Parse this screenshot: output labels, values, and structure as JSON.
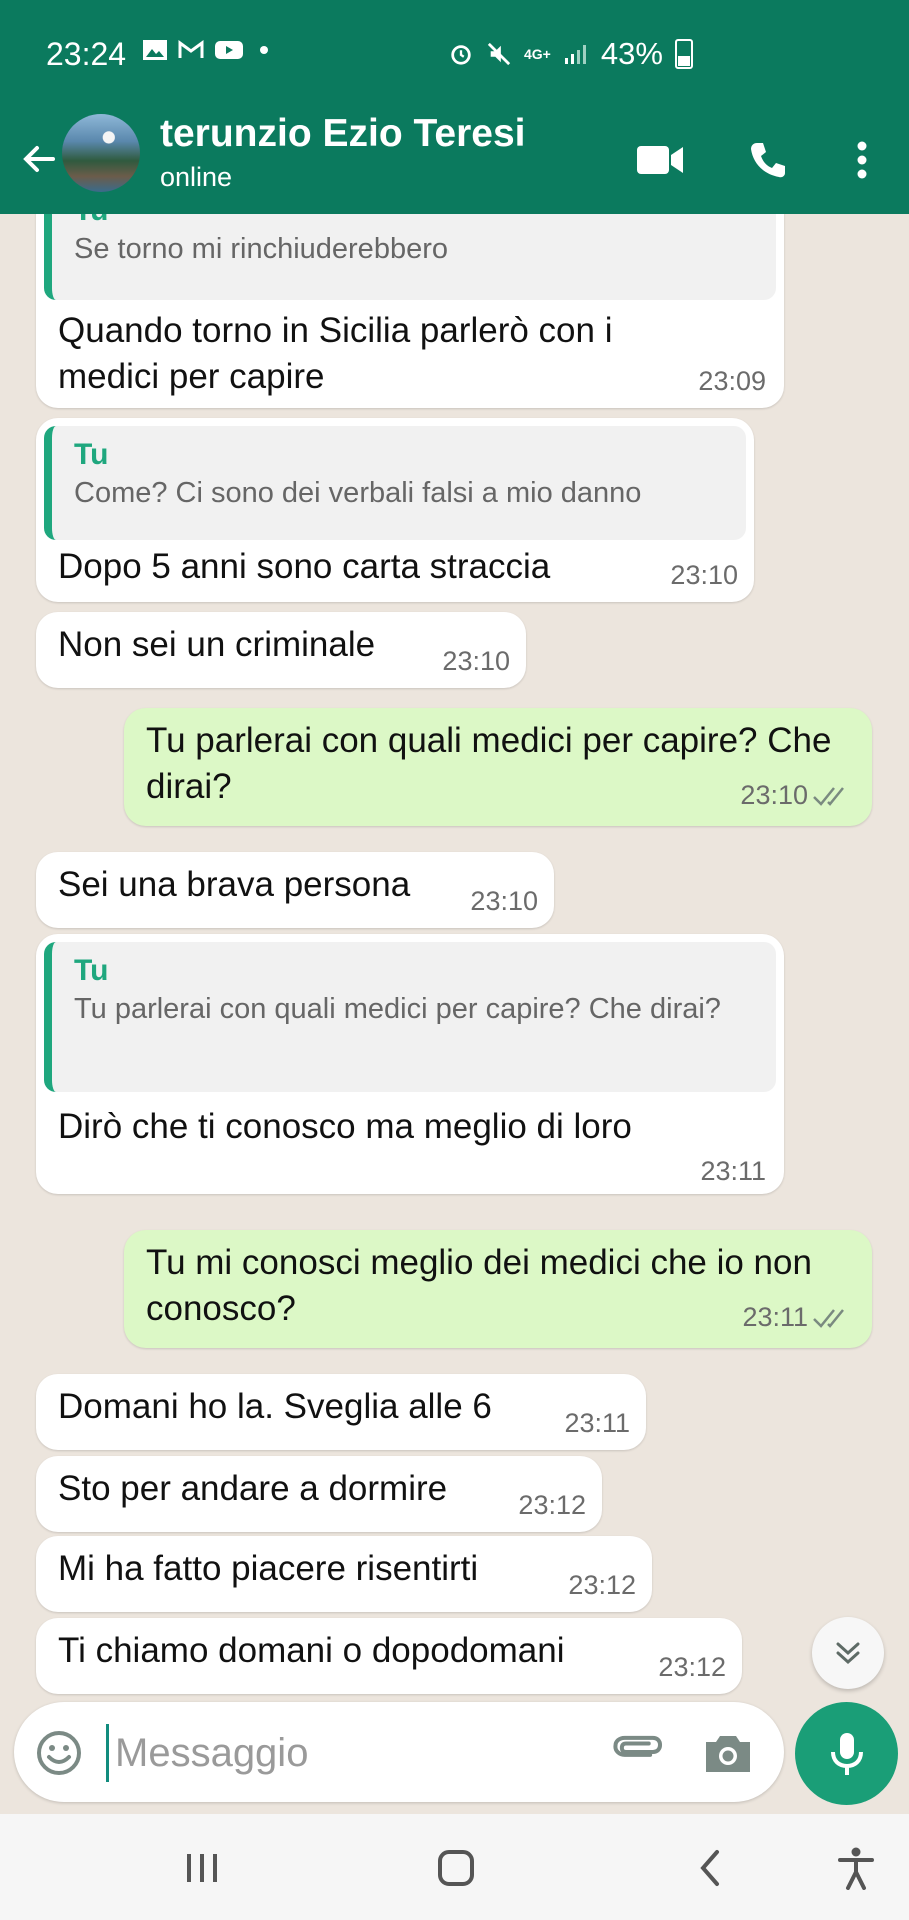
{
  "status_bar": {
    "time": "23:24",
    "battery_percent": "43%",
    "network": "4G+"
  },
  "header": {
    "contact_name": "terunzio Ezio Teresi",
    "status": "online"
  },
  "messages": [
    {
      "dir": "in",
      "quote_author": "Tu",
      "quote": "Se torno mi rinchiuderebbero",
      "text": "Quando torno in Sicilia parlerò con i medici per capire",
      "time": "23:09"
    },
    {
      "dir": "in",
      "quote_author": "Tu",
      "quote": "Come? Ci sono dei verbali falsi a mio danno",
      "text": "Dopo 5 anni sono carta straccia",
      "time": "23:10"
    },
    {
      "dir": "in",
      "text": "Non sei un criminale",
      "time": "23:10"
    },
    {
      "dir": "out",
      "text": "Tu parlerai con quali medici per capire? Che dirai?",
      "time": "23:10"
    },
    {
      "dir": "in",
      "text": "Sei una brava persona",
      "time": "23:10"
    },
    {
      "dir": "in",
      "quote_author": "Tu",
      "quote": "Tu parlerai con quali medici per capire? Che dirai?",
      "text": "Dirò che ti conosco ma meglio di loro",
      "time": "23:11"
    },
    {
      "dir": "out",
      "text": "Tu mi conosci meglio dei medici che io non conosco?",
      "time": "23:11"
    },
    {
      "dir": "in",
      "text": "Domani ho la. Sveglia alle 6",
      "time": "23:11"
    },
    {
      "dir": "in",
      "text": "Sto per andare a dormire",
      "time": "23:12"
    },
    {
      "dir": "in",
      "text": "Mi ha fatto piacere risentirti",
      "time": "23:12"
    },
    {
      "dir": "in",
      "text": "Ti chiamo domani o dopodomani",
      "time": "23:12"
    }
  ],
  "input": {
    "placeholder": "Messaggio"
  },
  "colors": {
    "header": "#0b7a5e",
    "outgoing": "#dcf8c6",
    "incoming": "#ffffff",
    "accent": "#1fa77e"
  },
  "icons": [
    "back-arrow-icon",
    "video-call-icon",
    "phone-icon",
    "more-vert-icon",
    "emoji-icon",
    "attach-icon",
    "camera-icon",
    "mic-icon",
    "scroll-down-icon"
  ]
}
